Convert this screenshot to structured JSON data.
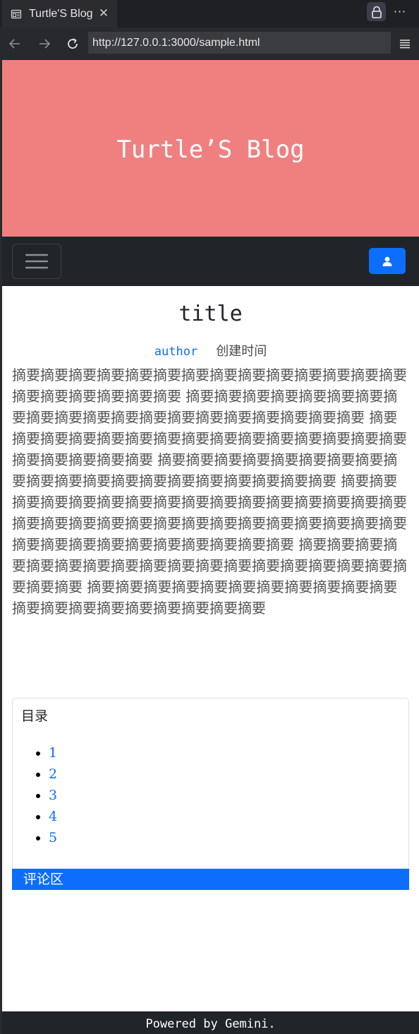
{
  "browser": {
    "tab": {
      "title": "Turtle'S Blog",
      "icon": "page-icon",
      "close_icon": "close-icon"
    },
    "toolbar": {
      "lock_icon": "lock-icon",
      "more_label": "···",
      "back_icon": "arrow-left-icon",
      "forward_icon": "arrow-right-icon",
      "reload_icon": "reload-icon",
      "menu_icon": "menu-icon"
    },
    "address": {
      "url": "http://127.0.0.1:3000/sample.html"
    }
  },
  "page": {
    "hero": {
      "title": "Turtle’S Blog",
      "background": "#f08080"
    },
    "navbar": {
      "toggler_icon": "hamburger-icon",
      "user_icon": "user-icon",
      "user_button_color": "#0d6efd"
    },
    "article": {
      "title": "title",
      "author": "author",
      "created_label": "创建时间",
      "summary": "摘要摘要摘要摘要摘要摘要摘要摘要摘要摘要摘要摘要摘要摘要摘要摘要摘要摘要摘要摘要 摘要摘要摘要摘要摘要摘要摘要摘要摘要摘要摘要摘要摘要摘要摘要摘要摘要摘要摘要摘要 摘要摘要摘要摘要摘要摘要摘要摘要摘要摘要摘要摘要摘要摘要摘要摘要摘要摘要摘要摘要 摘要摘要摘要摘要摘要摘要摘要摘要摘要摘要摘要摘要摘要摘要摘要摘要摘要摘要摘要摘要 摘要摘要摘要摘要摘要摘要摘要摘要摘要摘要摘要摘要摘要摘要摘要摘要摘要摘要摘要摘要摘要摘要摘要摘要摘要摘要摘要摘要摘要摘要摘要摘要摘要摘要摘要摘要摘要摘要摘要摘要 摘要摘要摘要摘要摘要摘要摘要摘要摘要摘要摘要摘要摘要摘要摘要摘要摘要摘要摘要摘要 摘要摘要摘要摘要摘要摘要摘要摘要摘要摘要摘要摘要摘要摘要摘要摘要摘要摘要摘要摘要"
    },
    "toc": {
      "title": "目录",
      "items": [
        "1",
        "2",
        "3",
        "4",
        "5"
      ]
    },
    "comments": {
      "label": "评论区",
      "bar_color": "#0d6efd"
    },
    "footer": {
      "text": "Powered by Gemini."
    }
  }
}
